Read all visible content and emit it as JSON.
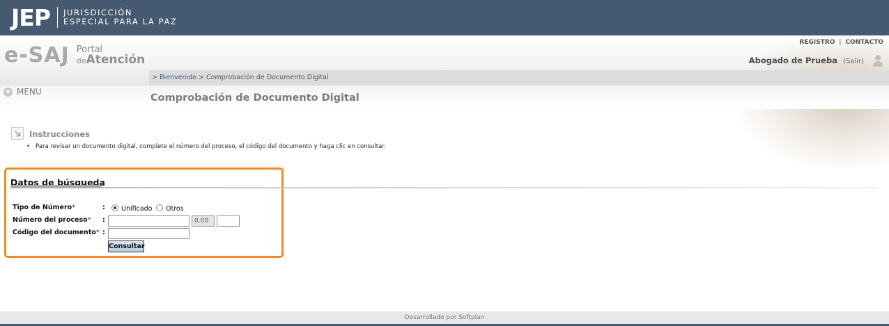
{
  "topbar": {
    "logo_letters": "JEP",
    "logo_line1": "JURISDICCIÓN",
    "logo_line2": "ESPECIAL PARA LA PAZ"
  },
  "brand": {
    "name": "e-SAJ",
    "portal_line1": "Portal",
    "portal_de": "de",
    "portal_atencion": "Atención"
  },
  "top_links": {
    "registro": "REGISTRO",
    "separator": "|",
    "contacto": "CONTACTO"
  },
  "user": {
    "name": "Abogado de Prueba",
    "logout": "(Salir)",
    "icon": "user-icon"
  },
  "breadcrumb": {
    "prefix": ">",
    "home": "Bienvenido",
    "sep": ">",
    "current": "Comprobación de Documento Digital"
  },
  "menu": {
    "label": "MENU",
    "icon": "chevron-down-icon"
  },
  "page_title": "Comprobación de Documento Digital",
  "instructions": {
    "title": "Instrucciones",
    "bullet": "•",
    "text": "Para revisar un documento digital, complete el número del proceso, el código del documento y haga clic en consultar."
  },
  "search": {
    "title": "Datos de búsqueda",
    "tipo_label": "Tipo de Número",
    "numero_label": "Número del proceso",
    "codigo_label": "Código del documento",
    "required_mark": "*",
    "colon": ":",
    "radio_unificado": "Unificado",
    "radio_otros": "Otros",
    "selected": "Unificado",
    "numero_value": "",
    "numero_foro_value": "0.00",
    "numero_extra_value": "",
    "codigo_value": "",
    "button": "Consultar"
  },
  "footer": {
    "text": "Desarrollado por Softplan"
  },
  "colors": {
    "topbar": "#455a70",
    "highlight_border": "#f08a24",
    "button": "#c9d8ea"
  }
}
